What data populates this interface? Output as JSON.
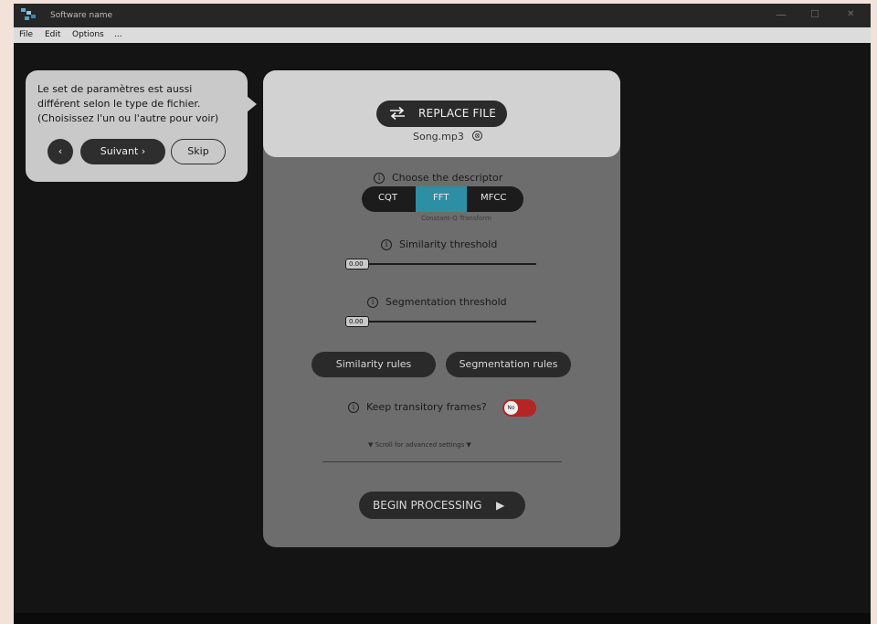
{
  "window": {
    "title": "Software name",
    "controls": {
      "minimize": "—",
      "maximize": "☐",
      "close": "✕"
    }
  },
  "menubar": {
    "items": [
      "File",
      "Edit",
      "Options",
      "..."
    ]
  },
  "tutorial": {
    "lines": [
      "Le set de paramètres est aussi",
      "différent selon le type de fichier.",
      "(Choisissez l'un ou l'autre pour voir)"
    ],
    "prev_label": "‹",
    "next_label": "Suivant ›",
    "skip_label": "Skip"
  },
  "file": {
    "replace_label": "REPLACE FILE",
    "filename": "Song.mp3",
    "remove_icon": "⊗"
  },
  "descriptor": {
    "heading": "Choose the descriptor",
    "options": [
      "CQT",
      "FFT",
      "MFCC"
    ],
    "selected": "FFT",
    "caption": "Constant-Q Transform"
  },
  "similarity": {
    "label": "Similarity threshold",
    "value": "0.00"
  },
  "segmentation": {
    "label": "Segmentation threshold",
    "value": "0.00"
  },
  "rules": {
    "similarity_label": "Similarity rules",
    "segmentation_label": "Segmentation rules"
  },
  "transitory": {
    "label": "Keep transitory frames?",
    "toggle_text": "No"
  },
  "advanced": {
    "hint": "▼  Scroll for advanced settings  ▼"
  },
  "begin": {
    "label": "BEGIN PROCESSING",
    "icon": "▶"
  },
  "icons": {
    "info": "i"
  },
  "colors": {
    "accent": "#2d8fa3",
    "toggle_off": "#b62525",
    "panel": "#6d6d6d"
  }
}
